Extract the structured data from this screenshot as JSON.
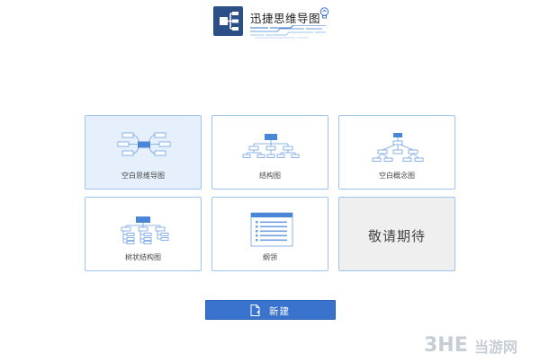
{
  "app": {
    "title": "迅捷思维导图"
  },
  "templates": [
    {
      "label": "空白思维导图",
      "icon": "mindmap-icon",
      "state": "selected"
    },
    {
      "label": "结构图",
      "icon": "org-chart-icon",
      "state": "normal"
    },
    {
      "label": "空白概念图",
      "icon": "concept-map-icon",
      "state": "normal"
    },
    {
      "label": "树状结构图",
      "icon": "tree-chart-icon",
      "state": "normal"
    },
    {
      "label": "纲领",
      "icon": "outline-icon",
      "state": "normal"
    },
    {
      "label": "敬请期待",
      "icon": "",
      "state": "disabled"
    }
  ],
  "actions": {
    "new_label": "新建",
    "new_icon": "new-file-icon"
  },
  "watermark": {
    "text": "当游网",
    "mark": "3HE"
  },
  "colors": {
    "accent": "#3a73cd",
    "card_border": "#9ec4ee",
    "selected_bg": "#e6f0fd",
    "logo_bg": "#2b4f86"
  }
}
